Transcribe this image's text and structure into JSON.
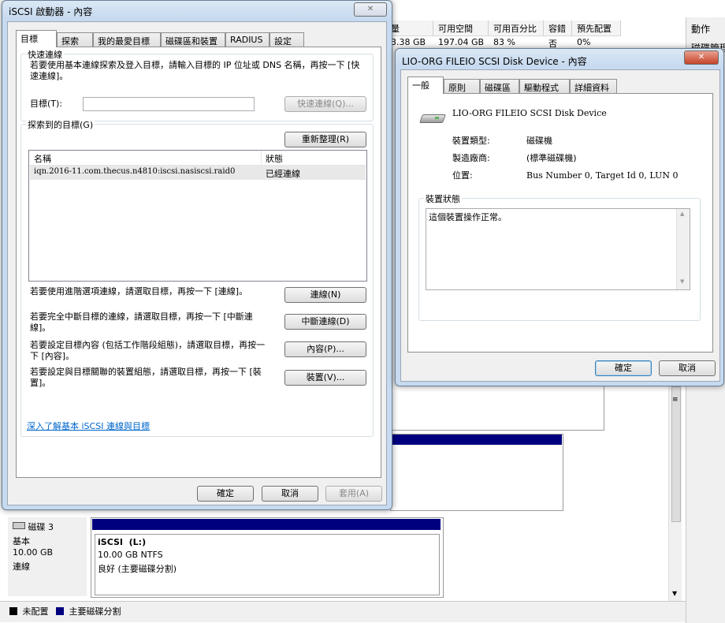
{
  "background": {
    "volume_columns": [
      "量",
      "可用空間",
      "可用百分比",
      "容錯",
      "預先配置"
    ],
    "volume_row": [
      "3.38 GB",
      "197.04 GB",
      "83 %",
      "否",
      "0%"
    ],
    "actions_header": "動作",
    "actions_item": "磁碟管理",
    "disk3": {
      "name": "磁碟 3",
      "type": "基本",
      "size": "10.00 GB",
      "status": "連線",
      "volume_name": "iSCSI  (L:)",
      "volume_size": "10.00 GB NTFS",
      "volume_status": "良好 (主要磁碟分割)"
    },
    "legend": {
      "unallocated": "未配置",
      "primary": "主要磁碟分割"
    },
    "colors": {
      "primary": "#00007f",
      "unallocated": "#000000"
    }
  },
  "iscsi": {
    "title": "iSCSI 啟動器 - 內容",
    "tabs": [
      "目標",
      "探索",
      "我的最愛目標",
      "磁碟區和裝置",
      "RADIUS",
      "設定"
    ],
    "quick": {
      "group": "快速連線",
      "desc": "若要使用基本連線探索及登入目標，請輸入目標的 IP 位址或 DNS 名稱，再按一下 [快速連線]。",
      "target_label": "目標(T):",
      "target_value": "",
      "quick_button": "快速連線(Q)..."
    },
    "discovered": {
      "group": "探索到的目標(G)",
      "refresh_button": "重新整理(R)",
      "col_name": "名稱",
      "col_status": "狀態",
      "rows": [
        {
          "name": "iqn.2016-11.com.thecus.n4810:iscsi.nasiscsi.raid0",
          "status": "已經連線"
        }
      ]
    },
    "actions": [
      {
        "text": "若要使用進階選項連線，請選取目標，再按一下 [連線]。",
        "button": "連線(N)"
      },
      {
        "text": "若要完全中斷目標的連線，請選取目標，再按一下 [中斷連線]。",
        "button": "中斷連線(D)"
      },
      {
        "text": "若要設定目標內容 (包括工作階段組態)，請選取目標，再按一下 [內容]。",
        "button": "內容(P)..."
      },
      {
        "text": "若要設定與目標關聯的裝置組態，請選取目標，再按一下 [裝置]。",
        "button": "裝置(V)..."
      }
    ],
    "learn_link": "深入了解基本 iSCSI 連線與目標",
    "ok": "確定",
    "cancel": "取消",
    "apply": "套用(A)",
    "close_glyph": "✕"
  },
  "device": {
    "title": "LIO-ORG FILEIO SCSI Disk Device - 內容",
    "tabs": [
      "一般",
      "原則",
      "磁碟區",
      "驅動程式",
      "詳細資料"
    ],
    "name": "LIO-ORG FILEIO SCSI Disk Device",
    "type_label": "裝置類型:",
    "type_value": "磁碟機",
    "mfr_label": "製造廠商:",
    "mfr_value": "(標準磁碟機)",
    "loc_label": "位置:",
    "loc_value": "Bus Number 0, Target Id 0, LUN 0",
    "status_group": "裝置狀態",
    "status_text": "這個裝置操作正常。",
    "ok": "確定",
    "cancel": "取消",
    "close_glyph": "✕"
  }
}
